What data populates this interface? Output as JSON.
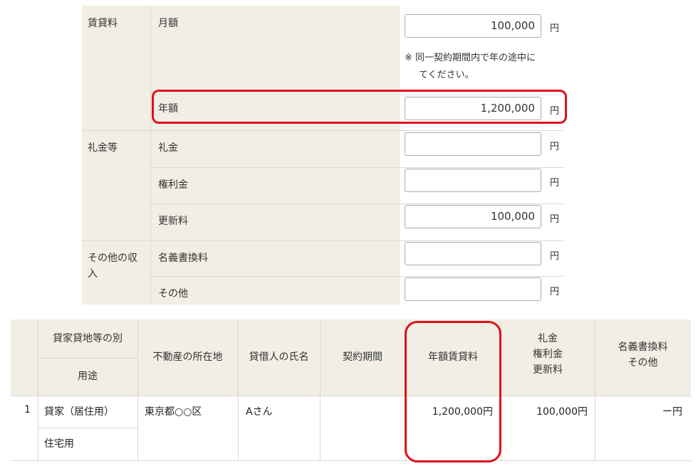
{
  "form": {
    "rent": {
      "group_label": "賃貸料",
      "monthly": {
        "label": "月額",
        "value": "100,000",
        "unit": "円"
      },
      "note_line1": "※ 同一契約期間内で年の途中に",
      "note_line2": "てください。",
      "annual": {
        "label": "年額",
        "value": "1,200,000",
        "unit": "円"
      }
    },
    "key_money": {
      "group_label": "礼金等",
      "reikin": {
        "label": "礼金",
        "value": "",
        "unit": "円"
      },
      "kenrikin": {
        "label": "権利金",
        "value": "",
        "unit": "円"
      },
      "koshinryo": {
        "label": "更新料",
        "value": "100,000",
        "unit": "円"
      }
    },
    "other_income": {
      "group_label": "その他の収入",
      "meigi": {
        "label": "名義書換料",
        "value": "",
        "unit": "円"
      },
      "other": {
        "label": "その他",
        "value": "",
        "unit": "円"
      }
    }
  },
  "summary_table": {
    "headers": {
      "type_top": "貸家貸地等の別",
      "type_bottom": "用途",
      "location": "不動産の所在地",
      "lessee": "貸借人の氏名",
      "period": "契約期間",
      "annual_rent": "年額賃貸料",
      "key_money_line1": "礼金",
      "key_money_line2": "権利金",
      "key_money_line3": "更新料",
      "meigi_line1": "名義書換料",
      "meigi_line2": "その他"
    },
    "row": {
      "index": "1",
      "type": "貸家（居住用）",
      "use": "住宅用",
      "location": "東京都○○区",
      "lessee": "Aさん",
      "period": "",
      "annual_rent": "1,200,000円",
      "key_money": "100,000円",
      "meigi": "ー円"
    }
  },
  "colors": {
    "highlight": "#e0101e",
    "header_bg": "#f1eee4"
  }
}
